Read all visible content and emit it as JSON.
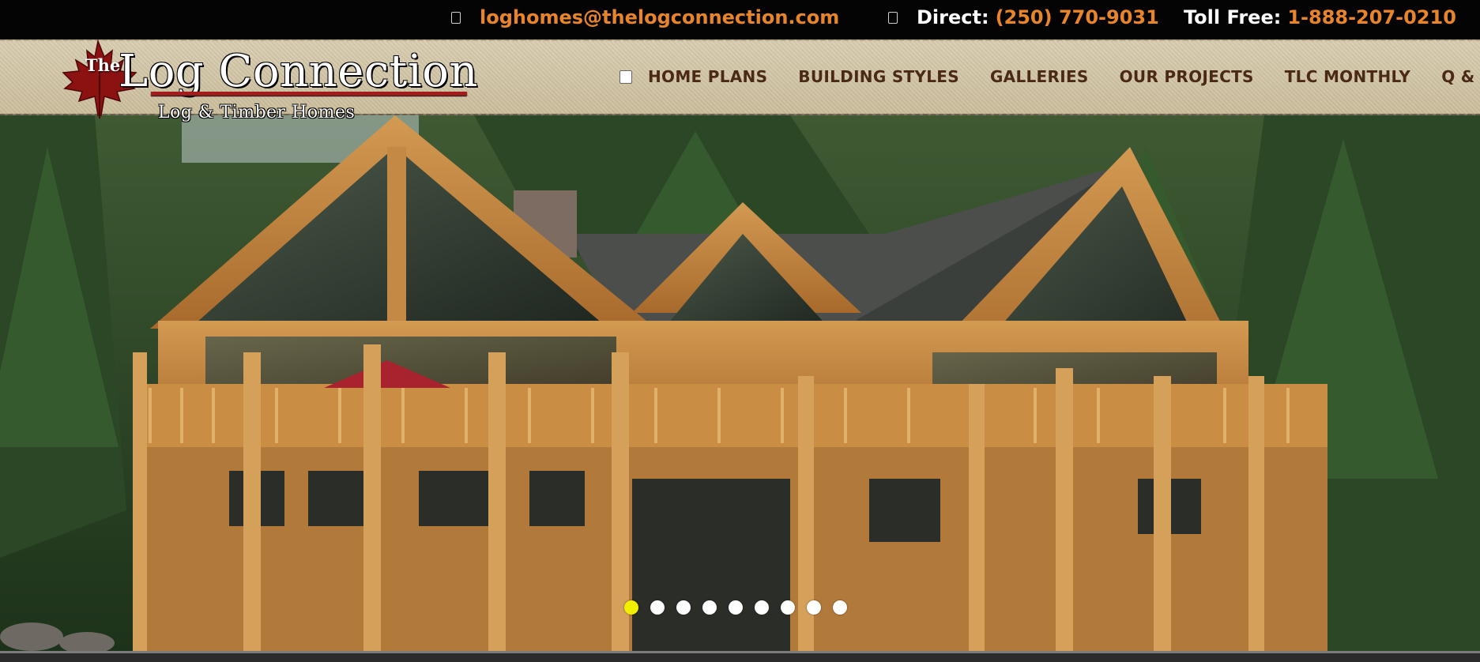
{
  "topbar": {
    "email": "loghomes@thelogconnection.com",
    "direct_label": "Direct:",
    "direct_phone": "(250) 770-9031",
    "tollfree_label": "Toll Free:",
    "tollfree_phone": "1-888-207-0210",
    "icons": [
      "email-icon",
      "phone-icon"
    ]
  },
  "logo": {
    "the": "The",
    "name": "Log Connection",
    "tagline": "Log & Timber Homes",
    "emblem": "maple-leaf-icon"
  },
  "nav": {
    "items": [
      "HOME PLANS",
      "BUILDING STYLES",
      "GALLERIES",
      "OUR PROJECTS",
      "TLC MONTHLY",
      "Q & A"
    ]
  },
  "slider": {
    "slide_count": 9,
    "active_index": 0
  },
  "colors": {
    "accent_orange": "#e8842a",
    "nav_text": "#4a2a16",
    "logo_red": "#a51a1a",
    "active_dot": "#f2ef00"
  }
}
